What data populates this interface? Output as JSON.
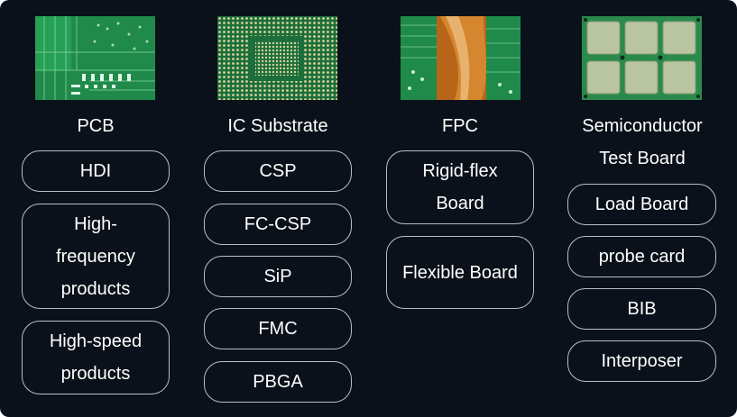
{
  "columns": [
    {
      "title": "PCB",
      "image_icon": "pcb-image",
      "items": [
        "HDI",
        "High-frequency products",
        "High-speed products"
      ]
    },
    {
      "title": "IC Substrate",
      "image_icon": "ic-substrate-image",
      "items": [
        "CSP",
        "FC-CSP",
        "SiP",
        "FMC",
        "PBGA"
      ]
    },
    {
      "title": "FPC",
      "image_icon": "fpc-image",
      "items": [
        "Rigid-flex Board",
        "Flexible Board"
      ]
    },
    {
      "title": "Semiconductor Test Board",
      "image_icon": "test-board-image",
      "items": [
        "Load Board",
        "probe card",
        "BIB",
        "Interposer"
      ]
    }
  ],
  "colors": {
    "background": "#0b111a",
    "pill_border": "#b9bec6",
    "text": "#ffffff",
    "pcb_green": "#1f8a4a"
  }
}
